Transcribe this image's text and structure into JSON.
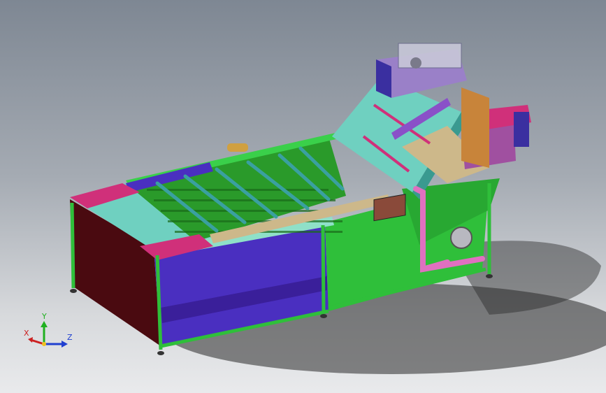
{
  "viewport": {
    "background_top": "#7e8793",
    "background_bottom": "#e9eaec"
  },
  "triad": {
    "x_label": "X",
    "y_label": "Y",
    "z_label": "Z",
    "x_color": "#cc2020",
    "y_color": "#20b020",
    "z_color": "#2040d0"
  },
  "model": {
    "description_icon": "washing-conveyor-machine",
    "colors": {
      "frame_green": "#2fbf3a",
      "tank_blue": "#4a2fc0",
      "tank_dark": "#4a0a10",
      "pink_caps": "#d0307a",
      "conveyor_cyan": "#6fd0c0",
      "pipe_pink": "#e070c0",
      "drive_lavender": "#9a80c8",
      "motor_box_purple": "#a050a0",
      "tan_plate": "#cdb88a"
    }
  }
}
